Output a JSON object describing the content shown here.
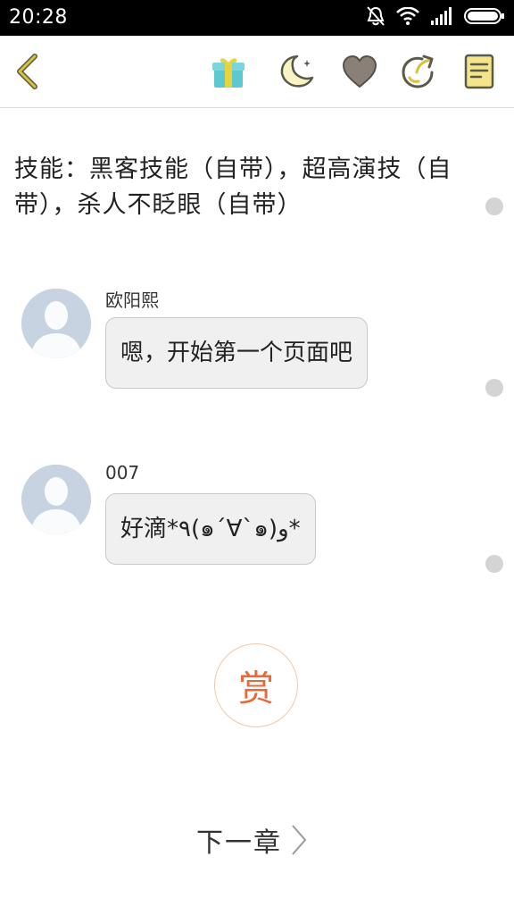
{
  "status_bar": {
    "time": "20:28"
  },
  "toolbar": {
    "back_icon": "chevron-left-icon",
    "actions": [
      "gift-icon",
      "moon-icon",
      "heart-icon",
      "share-icon",
      "note-icon"
    ]
  },
  "content": {
    "text": "技能：黑客技能（自带），超高演技（自带），杀人不眨眼（自带）"
  },
  "messages": [
    {
      "sender": "欧阳熙",
      "text": "嗯，开始第一个页面吧"
    },
    {
      "sender": "007",
      "text": "好滴*٩(๑´∀`๑)و*"
    }
  ],
  "reward": {
    "label": "赏"
  },
  "next_chapter": {
    "label": "下一章"
  },
  "colors": {
    "accent_yellow": "#c8b41e",
    "reward_orange": "#e8693a"
  }
}
